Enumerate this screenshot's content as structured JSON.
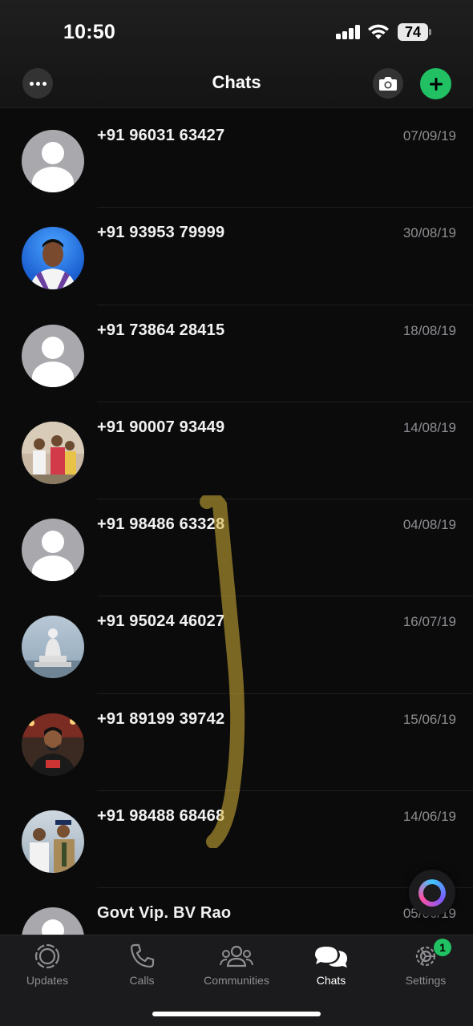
{
  "status_bar": {
    "time": "10:50",
    "battery": "74"
  },
  "header": {
    "title": "Chats",
    "more_icon": "ellipsis-icon",
    "camera_icon": "camera-icon",
    "new_chat_icon": "plus-icon"
  },
  "chats": [
    {
      "name": "+91 96031 63427",
      "date": "07/09/19",
      "avatar": "default"
    },
    {
      "name": "+91 93953 79999",
      "date": "30/08/19",
      "avatar": "photo"
    },
    {
      "name": "+91 73864 28415",
      "date": "18/08/19",
      "avatar": "default"
    },
    {
      "name": "+91 90007 93449",
      "date": "14/08/19",
      "avatar": "photo"
    },
    {
      "name": "+91 98486 63328",
      "date": "04/08/19",
      "avatar": "default"
    },
    {
      "name": "+91 95024 46027",
      "date": "16/07/19",
      "avatar": "photo"
    },
    {
      "name": "+91 89199 39742",
      "date": "15/06/19",
      "avatar": "photo"
    },
    {
      "name": "+91 98488 68468",
      "date": "14/06/19",
      "avatar": "photo"
    },
    {
      "name": "Govt Vip. BV Rao",
      "date": "05/06/19",
      "avatar": "default"
    }
  ],
  "tabs": [
    {
      "label": "Updates",
      "icon": "updates-icon"
    },
    {
      "label": "Calls",
      "icon": "phone-icon"
    },
    {
      "label": "Communities",
      "icon": "communities-icon"
    },
    {
      "label": "Chats",
      "icon": "chat-bubbles-icon",
      "active": true
    },
    {
      "label": "Settings",
      "icon": "gear-icon",
      "badge": "1"
    }
  ],
  "colors": {
    "accent": "#21c063",
    "background": "#0b0b0b",
    "secondary_text": "#8e8e93"
  }
}
